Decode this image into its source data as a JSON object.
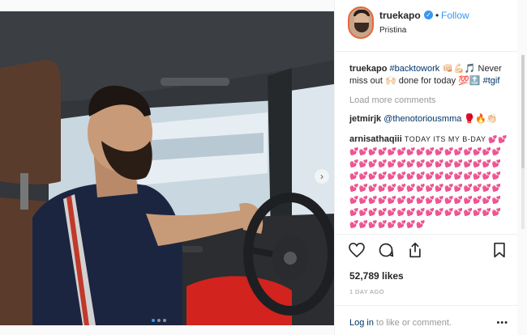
{
  "post": {
    "username": "truekapo",
    "follow_label": "Follow",
    "location": "Pristina",
    "separator": "•"
  },
  "comments": [
    {
      "user": "truekapo",
      "text_parts": [
        "#backtowork",
        " 👊🏻💪🏻🎵 Never miss out 🙌🏻 done for today 💯🔝 ",
        "#tgif"
      ]
    },
    {
      "user": "jetmirjk",
      "text_parts": [
        "@thenotoriousmma",
        " 🥊🔥👏🏻"
      ]
    },
    {
      "user": "arnisathaqiii",
      "text": "TODAY ITS MY B-DAY 💕💕💕💕💕💕💕💕💕💕💕💕💕💕💕💕💕💕💕💕💕💕💕💕💕💕💕💕💕💕💕💕💕💕💕💕💕💕💕💕💕💕💕💕💕💕💕💕💕💕💕💕💕💕💕💕💕💕💕💕💕💕💕💕💕💕💕💕💕💕💕💕💕💕💕💕💕💕💕💕💕💕💕💕💕💕💕💕💕💕💕💕💕💕💕💕💕💕💕💕💕💕💕💕💕💕"
    }
  ],
  "load_more": "Load more comments",
  "likes": "52,789 likes",
  "timestamp": "1 DAY AGO",
  "login_link": "Log in",
  "login_rest": " to like or comment.",
  "more_label": "•••",
  "colors": {
    "accent": "#3897f0",
    "link": "#003569",
    "muted": "#999999"
  }
}
